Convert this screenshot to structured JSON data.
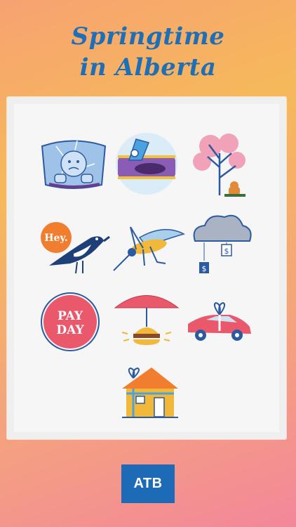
{
  "header": {
    "title_line1": "Springtime",
    "title_line2": "in Alberta"
  },
  "stickers": [
    {
      "name": "cracked-windshield-sticker"
    },
    {
      "name": "pothole-sticker"
    },
    {
      "name": "spring-tree-gopher-sticker"
    },
    {
      "name": "magpie-hey-sticker",
      "text": "Hey."
    },
    {
      "name": "mosquito-sticker"
    },
    {
      "name": "money-rain-cloud-sticker",
      "tag": "$"
    },
    {
      "name": "payday-stamp-sticker",
      "line1": "PAY",
      "line2": "DAY"
    },
    {
      "name": "burger-umbrella-sticker"
    },
    {
      "name": "gift-car-sticker"
    },
    {
      "name": "gift-house-sticker"
    }
  ],
  "footer": {
    "logo_text": "ATB"
  },
  "colors": {
    "title": "#1f6fb8",
    "logo_bg": "#1d6bb6",
    "panel": "#f6f6f6"
  }
}
